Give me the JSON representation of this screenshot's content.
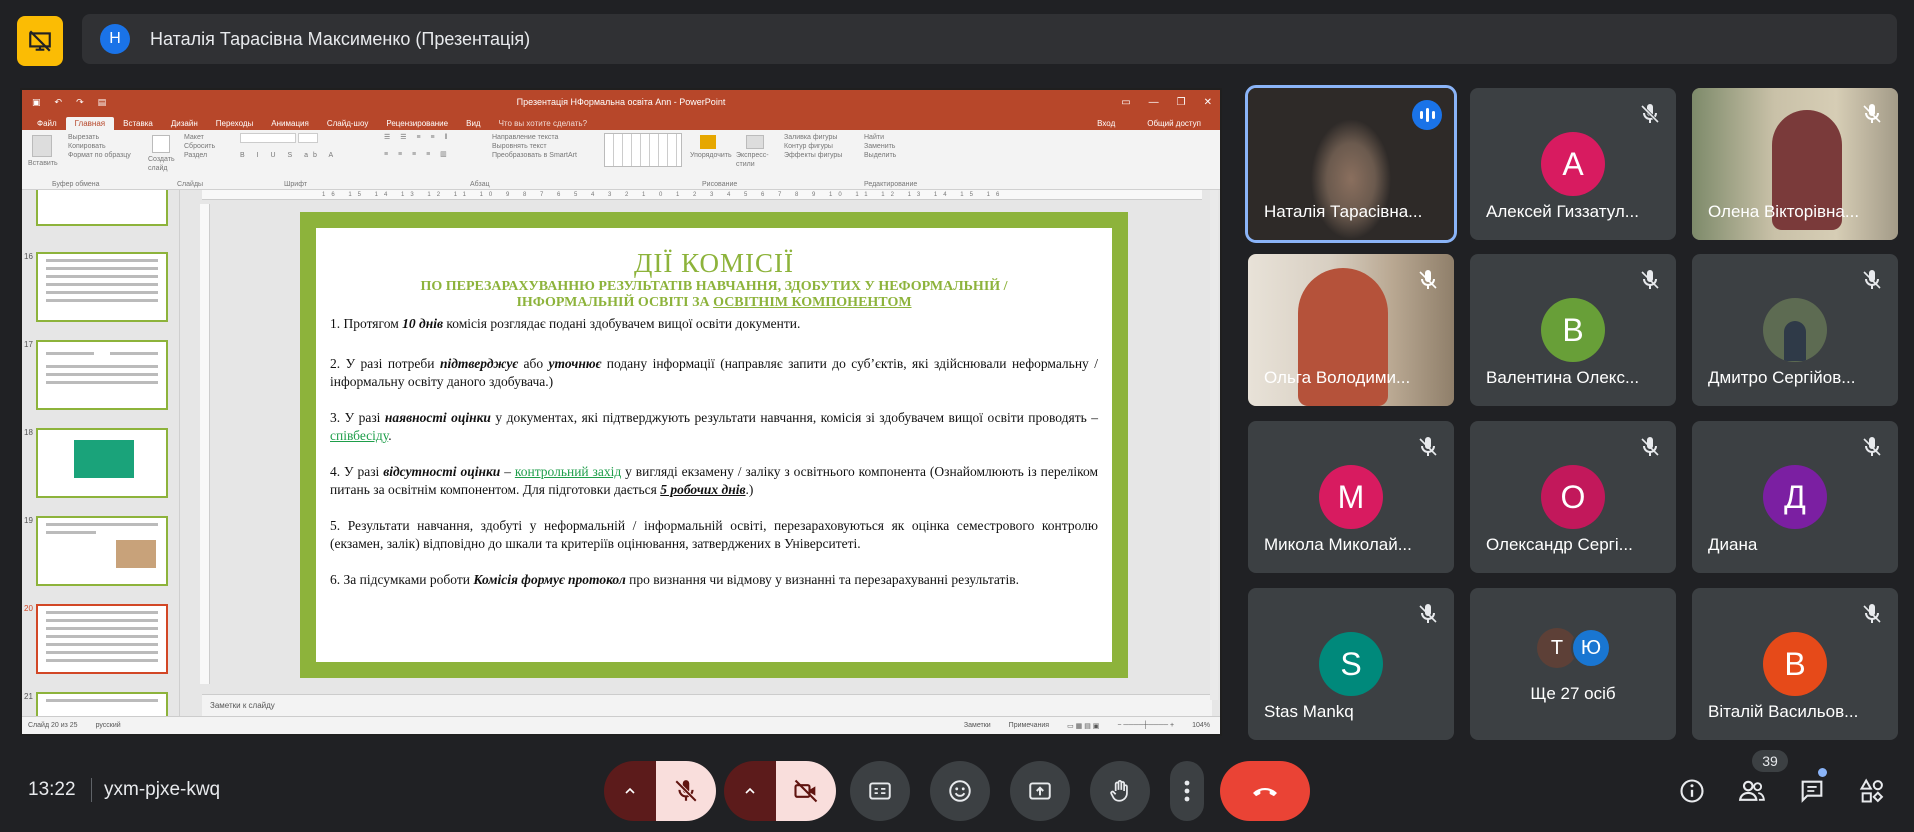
{
  "meeting": {
    "presenter_initial": "Н",
    "presenting_title": "Наталія Тарасівна Максименко (Презентація)",
    "time": "13:22",
    "code": "yxm-pjxe-kwq",
    "participants_count": "39"
  },
  "powerpoint": {
    "window_title": "Презентація НФормальна освіта Ann - PowerPoint",
    "menu": [
      "Файл",
      "Главная",
      "Вставка",
      "Дизайн",
      "Переходы",
      "Анимация",
      "Слайд-шоу",
      "Рецензирование",
      "Вид"
    ],
    "tell_me": "Что вы хотите сделать?",
    "signin": "Вход",
    "share": "Общий доступ",
    "ribbon": {
      "clipboard": [
        "Вырезать",
        "Копировать",
        "Формат по образцу"
      ],
      "paste": "Вставить",
      "new_slide": "Создать слайд",
      "slides_opts": [
        "Макет",
        "Сбросить",
        "Раздел"
      ],
      "text_opts": [
        "Направление текста",
        "Выровнять текст",
        "Преобразовать в SmartArt"
      ],
      "arrange": "Упорядочить",
      "quick_styles": "Экспресс-стили",
      "shape_opts": [
        "Заливка фигуры",
        "Контур фигуры",
        "Эффекты фигуры"
      ],
      "edit_opts": [
        "Найти",
        "Заменить",
        "Выделить"
      ],
      "groups": [
        "Буфер обмена",
        "Слайды",
        "Шрифт",
        "Абзац",
        "Рисование",
        "Редактирование"
      ]
    },
    "thumb_numbers": [
      "16",
      "17",
      "18",
      "19",
      "20",
      "21"
    ],
    "ruler": "16 15 14 13 12 11 10 9 8 7 6 5 4 3 2 1 0 1 2 3 4 5 6 7 8 9 10 11 12 13 14 15 16",
    "notes_placeholder": "Заметки к слайду",
    "status": {
      "slide": "Слайд 20 из 25",
      "lang": "русский",
      "notes": "Заметки",
      "comments": "Примечания",
      "zoom": "104%"
    }
  },
  "slide": {
    "title": "ДІЇ КОМІСІЇ",
    "subtitle_1": "ПО ПЕРЕЗАРАХУВАННЮ РЕЗУЛЬТАТІВ НАВЧАННЯ,  ЗДОБУТИХ У НЕФОРМАЛЬНІЙ /",
    "subtitle_2": "ІНФОРМАЛЬНІЙ ОСВІТІ ЗА ",
    "subtitle_2u": "ОСВІТНІМ КОМПОНЕНТОМ",
    "p1_a": "1. Протягом ",
    "p1_b": "10 днів",
    "p1_c": " комісія розглядає  подані здобувачем вищої освіти документи.",
    "p2_a": "2. У разі потреби ",
    "p2_b": "підтверджує",
    "p2_c": " або ",
    "p2_d": "уточнює",
    "p2_e": " подану інформації (направляє запити до суб’єктів, які здійснювали неформальну / інформальну освіту даного здобувача.)",
    "p3_a": "3. У разі ",
    "p3_b": "наявності оцінки",
    "p3_c": " у документах, які підтверджують  результати навчання, комісія зі здобувачем вищої освіти проводять – ",
    "p3_link": "співбесіду",
    "p3_d": ".",
    "p4_a": "4. У разі ",
    "p4_b": "відсутності оцінки",
    "p4_c": " – ",
    "p4_link": "контрольний захід",
    "p4_d": " у вигляді екзамену / заліку з освітнього компонента (Ознайомлюють із переліком питань за освітнім компонентом. Для підготовки дається ",
    "p4_e": "5 робочих днів",
    "p4_f": ".)",
    "p5": "5. Результати навчання, здобуті у неформальній / інформальній освіті, перезараховуються як оцінка семестрового контролю (екзамен, залік) відповідно до шкали та критеріїв оцінювання, затверджених в Університеті.",
    "p6_a": "6. За підсумками роботи ",
    "p6_b": "Комісія формує протокол",
    "p6_c": " про визнання чи відмову у визнанні та перезарахуванні результатів."
  },
  "participants": [
    {
      "name": "Наталія Тарасівна...",
      "type": "photo",
      "speaking": true
    },
    {
      "name": "Алексей Гиззатул...",
      "initial": "А",
      "color": "#d81b60"
    },
    {
      "name": "Олена Вікторівна...",
      "type": "photo"
    },
    {
      "name": "Ольга Володими...",
      "type": "photo"
    },
    {
      "name": "Валентина Олекс...",
      "initial": "В",
      "color": "#689f38"
    },
    {
      "name": "Дмитро Сергійов...",
      "type": "small-photo"
    },
    {
      "name": "Микола Миколай...",
      "initial": "М",
      "color": "#d81b60"
    },
    {
      "name": "Олександр Сергі...",
      "initial": "О",
      "color": "#c2185b"
    },
    {
      "name": "Диана",
      "initial": "Д",
      "color": "#7b1fa2"
    },
    {
      "name": "Stas Mankq",
      "initial": "S",
      "color": "#00897b"
    },
    {
      "name": "Ще 27 осіб",
      "type": "more",
      "initials": [
        "Т",
        "Ю"
      ]
    },
    {
      "name": "Віталій Васильов...",
      "initial": "В",
      "color": "#e64a19"
    }
  ],
  "colors": {
    "accent": "#8ab4f8",
    "danger": "#ea4335",
    "ppt_brand": "#b7472a",
    "slide_green": "#8db33b"
  }
}
